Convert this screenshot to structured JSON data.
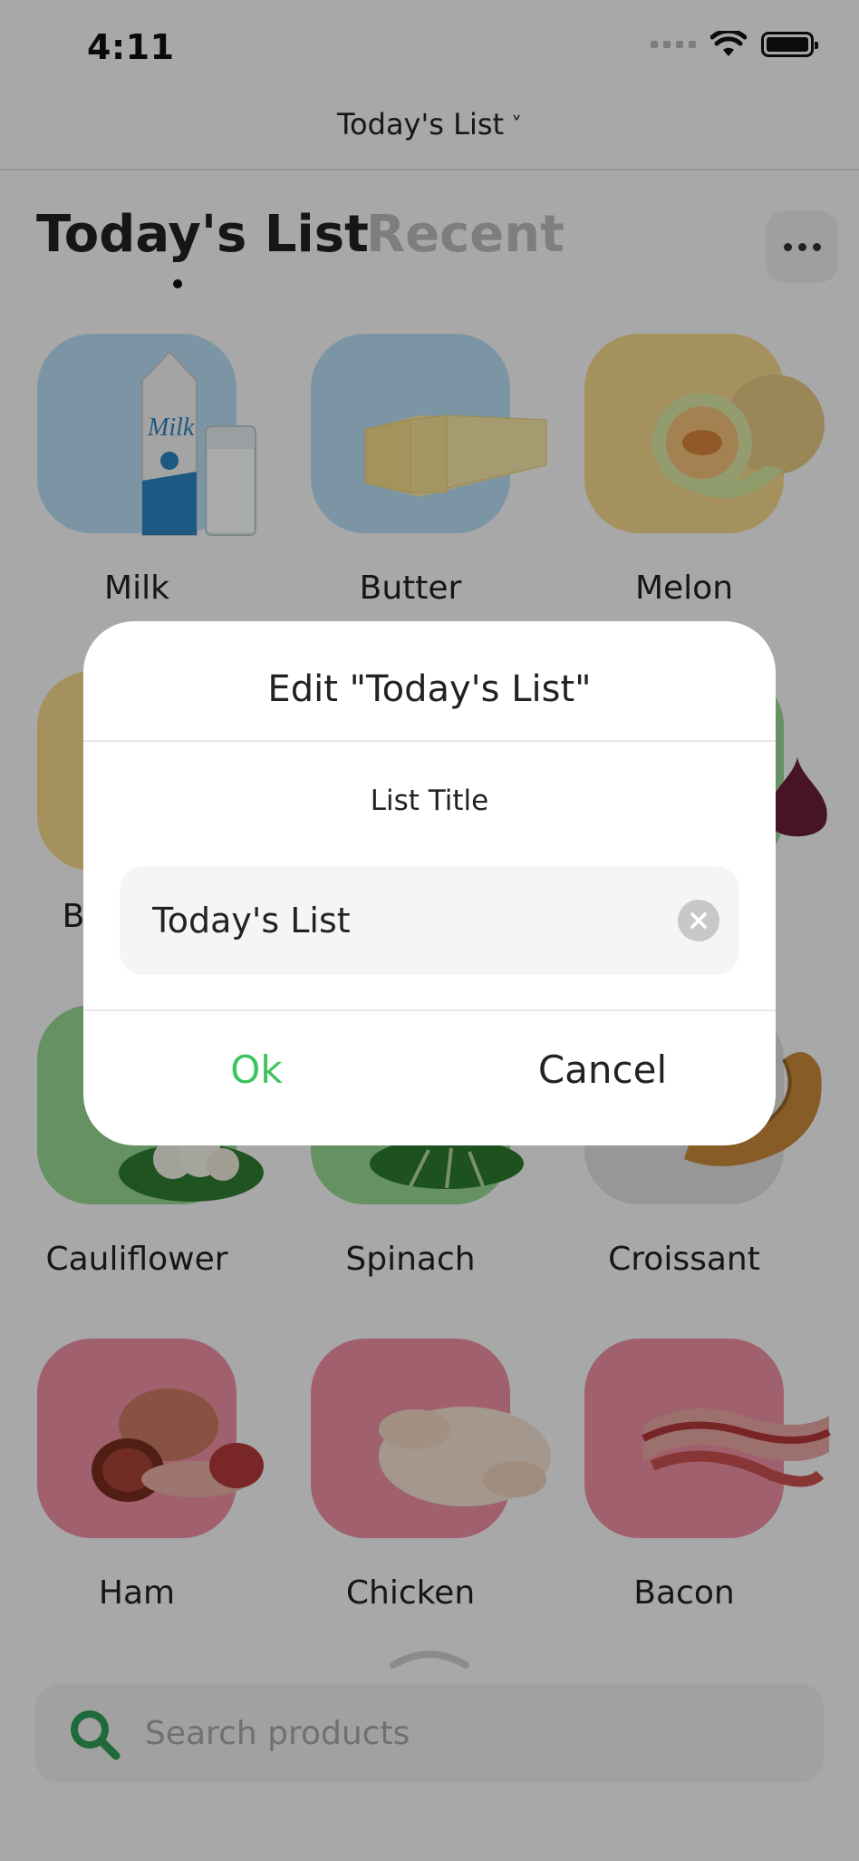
{
  "status_bar": {
    "time": "4:11"
  },
  "nav": {
    "title": "Today's List",
    "chevron": "˅"
  },
  "tabs": [
    {
      "label": "Today's List",
      "active": true
    },
    {
      "label": "Recent",
      "active": false
    }
  ],
  "products": [
    {
      "name": "Milk",
      "color": "blue"
    },
    {
      "name": "Butter",
      "color": "blue"
    },
    {
      "name": "Melon",
      "color": "yellow"
    },
    {
      "name": "B",
      "color": "yellow"
    },
    {
      "name": "Cauliflower",
      "color": "green"
    },
    {
      "name": "Spinach",
      "color": "green"
    },
    {
      "name": "Croissant",
      "color": "grey"
    },
    {
      "name": "Ham",
      "color": "red"
    },
    {
      "name": "Chicken",
      "color": "red"
    },
    {
      "name": "Bacon",
      "color": "red"
    }
  ],
  "dialog": {
    "title": "Edit \"Today's List\"",
    "field_label": "List Title",
    "field_value": "Today's List",
    "ok_label": "Ok",
    "cancel_label": "Cancel"
  },
  "search": {
    "placeholder": "Search products"
  },
  "colors": {
    "accent_green": "#3dc45f",
    "search_icon_green": "#2e9e57"
  }
}
